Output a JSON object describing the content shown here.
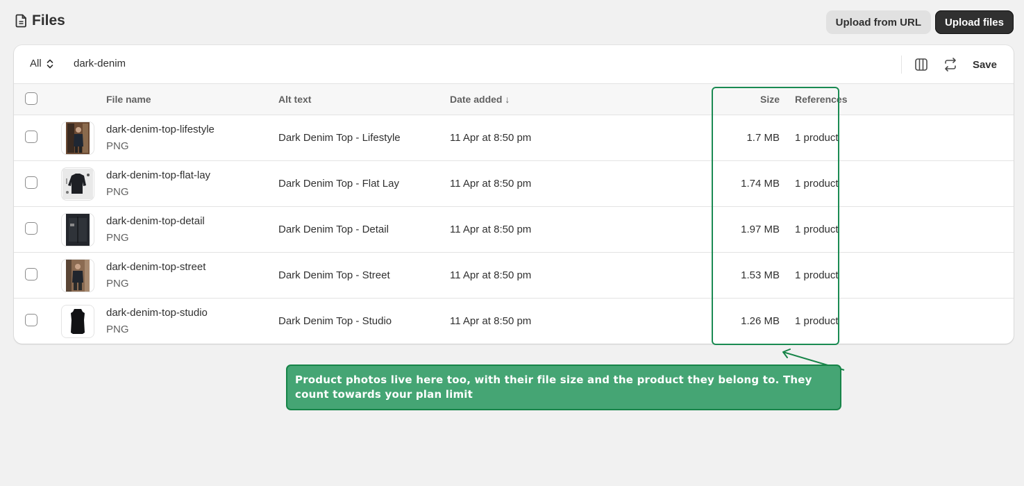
{
  "header": {
    "title": "Files",
    "upload_url_label": "Upload from URL",
    "upload_files_label": "Upload files"
  },
  "toolbar": {
    "filter_label": "All",
    "search_query": "dark-denim",
    "save_label": "Save"
  },
  "table": {
    "columns": {
      "file_name": "File name",
      "alt_text": "Alt text",
      "date_added": "Date added ↓",
      "size": "Size",
      "references": "References"
    },
    "rows": [
      {
        "name": "dark-denim-top-lifestyle",
        "type": "PNG",
        "alt": "Dark Denim Top - Lifestyle",
        "date": "11 Apr at 8:50 pm",
        "size": "1.7 MB",
        "refs": "1 product"
      },
      {
        "name": "dark-denim-top-flat-lay",
        "type": "PNG",
        "alt": "Dark Denim Top - Flat Lay",
        "date": "11 Apr at 8:50 pm",
        "size": "1.74 MB",
        "refs": "1 product"
      },
      {
        "name": "dark-denim-top-detail",
        "type": "PNG",
        "alt": "Dark Denim Top - Detail",
        "date": "11 Apr at 8:50 pm",
        "size": "1.97 MB",
        "refs": "1 product"
      },
      {
        "name": "dark-denim-top-street",
        "type": "PNG",
        "alt": "Dark Denim Top - Street",
        "date": "11 Apr at 8:50 pm",
        "size": "1.53 MB",
        "refs": "1 product"
      },
      {
        "name": "dark-denim-top-studio",
        "type": "PNG",
        "alt": "Dark Denim Top - Studio",
        "date": "11 Apr at 8:50 pm",
        "size": "1.26 MB",
        "refs": "1 product"
      }
    ]
  },
  "callout": {
    "text": "Product photos live here too, with their file size and the product they belong to. They count towards your plan limit"
  },
  "colors": {
    "accent_green": "#1a8a52",
    "callout_bg": "#45a574",
    "primary_button": "#303030"
  }
}
